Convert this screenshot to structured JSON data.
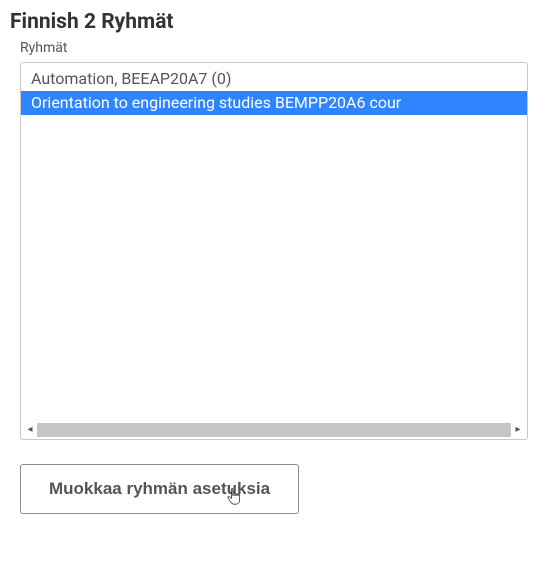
{
  "page": {
    "title": "Finnish 2 Ryhmät",
    "section_label": "Ryhmät"
  },
  "groups": {
    "items": [
      {
        "label": "Automation, BEEAP20A7 (0)",
        "selected": false
      },
      {
        "label": "Orientation to engineering studies BEMPP20A6 cour",
        "selected": true
      }
    ]
  },
  "actions": {
    "edit_label": "Muokkaa ryhmän asetuksia"
  }
}
